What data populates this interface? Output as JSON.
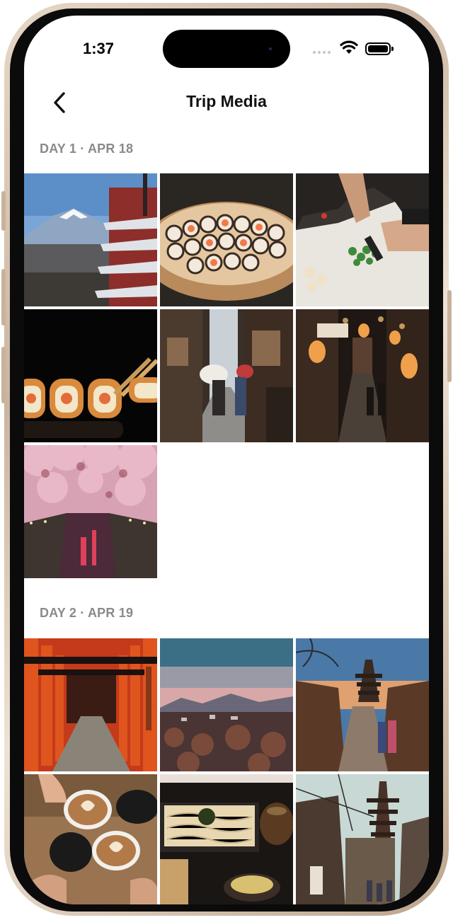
{
  "status_bar": {
    "time": "1:37"
  },
  "nav": {
    "title": "Trip Media",
    "back_icon": "chevron-left-icon"
  },
  "sections": [
    {
      "label": "DAY 1 · APR 18",
      "photos": [
        "mount-fuji-pagoda-photo",
        "sushi-platter-photo",
        "chopping-vegetables-photo",
        "sushi-rolls-chopsticks-photo",
        "kimono-umbrella-street-photo",
        "lantern-alley-night-photo",
        "cherry-blossom-canal-photo"
      ]
    },
    {
      "label": "DAY 2 · APR 19",
      "photos": [
        "torii-gates-path-photo",
        "city-sunset-mountains-photo",
        "pagoda-street-kimono-photo",
        "latte-art-cups-photo",
        "soba-noodles-meal-photo",
        "yasaka-pagoda-street-photo"
      ]
    }
  ],
  "colors": {
    "accent": "#000000",
    "section_label": "#8a8a8a",
    "frame": "#d8c4b0"
  }
}
